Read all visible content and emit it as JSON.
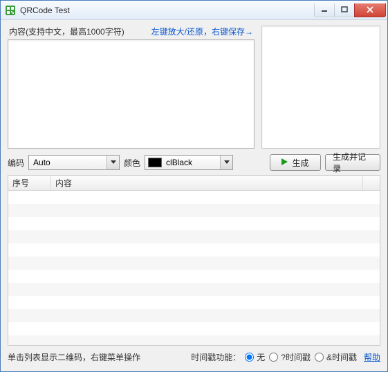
{
  "window": {
    "title": "QRCode Test"
  },
  "content": {
    "label": "内容(支持中文，最高1000字符)",
    "hint": "左键放大/还原，右键保存→",
    "value": ""
  },
  "encoding": {
    "label": "编码",
    "value": "Auto"
  },
  "color": {
    "label": "颜色",
    "name": "clBlack",
    "hex": "#000000"
  },
  "buttons": {
    "generate": "生成",
    "generate_and_record": "生成并记录"
  },
  "list": {
    "col_index": "序号",
    "col_content": "内容"
  },
  "footer": {
    "hint": "单击列表显示二维码，右键菜单操作",
    "ts_label": "时间戳功能：",
    "radio_none": "无",
    "radio_q": "?时间戳",
    "radio_amp": "&时间戳",
    "selected": "none",
    "help": "帮助"
  }
}
